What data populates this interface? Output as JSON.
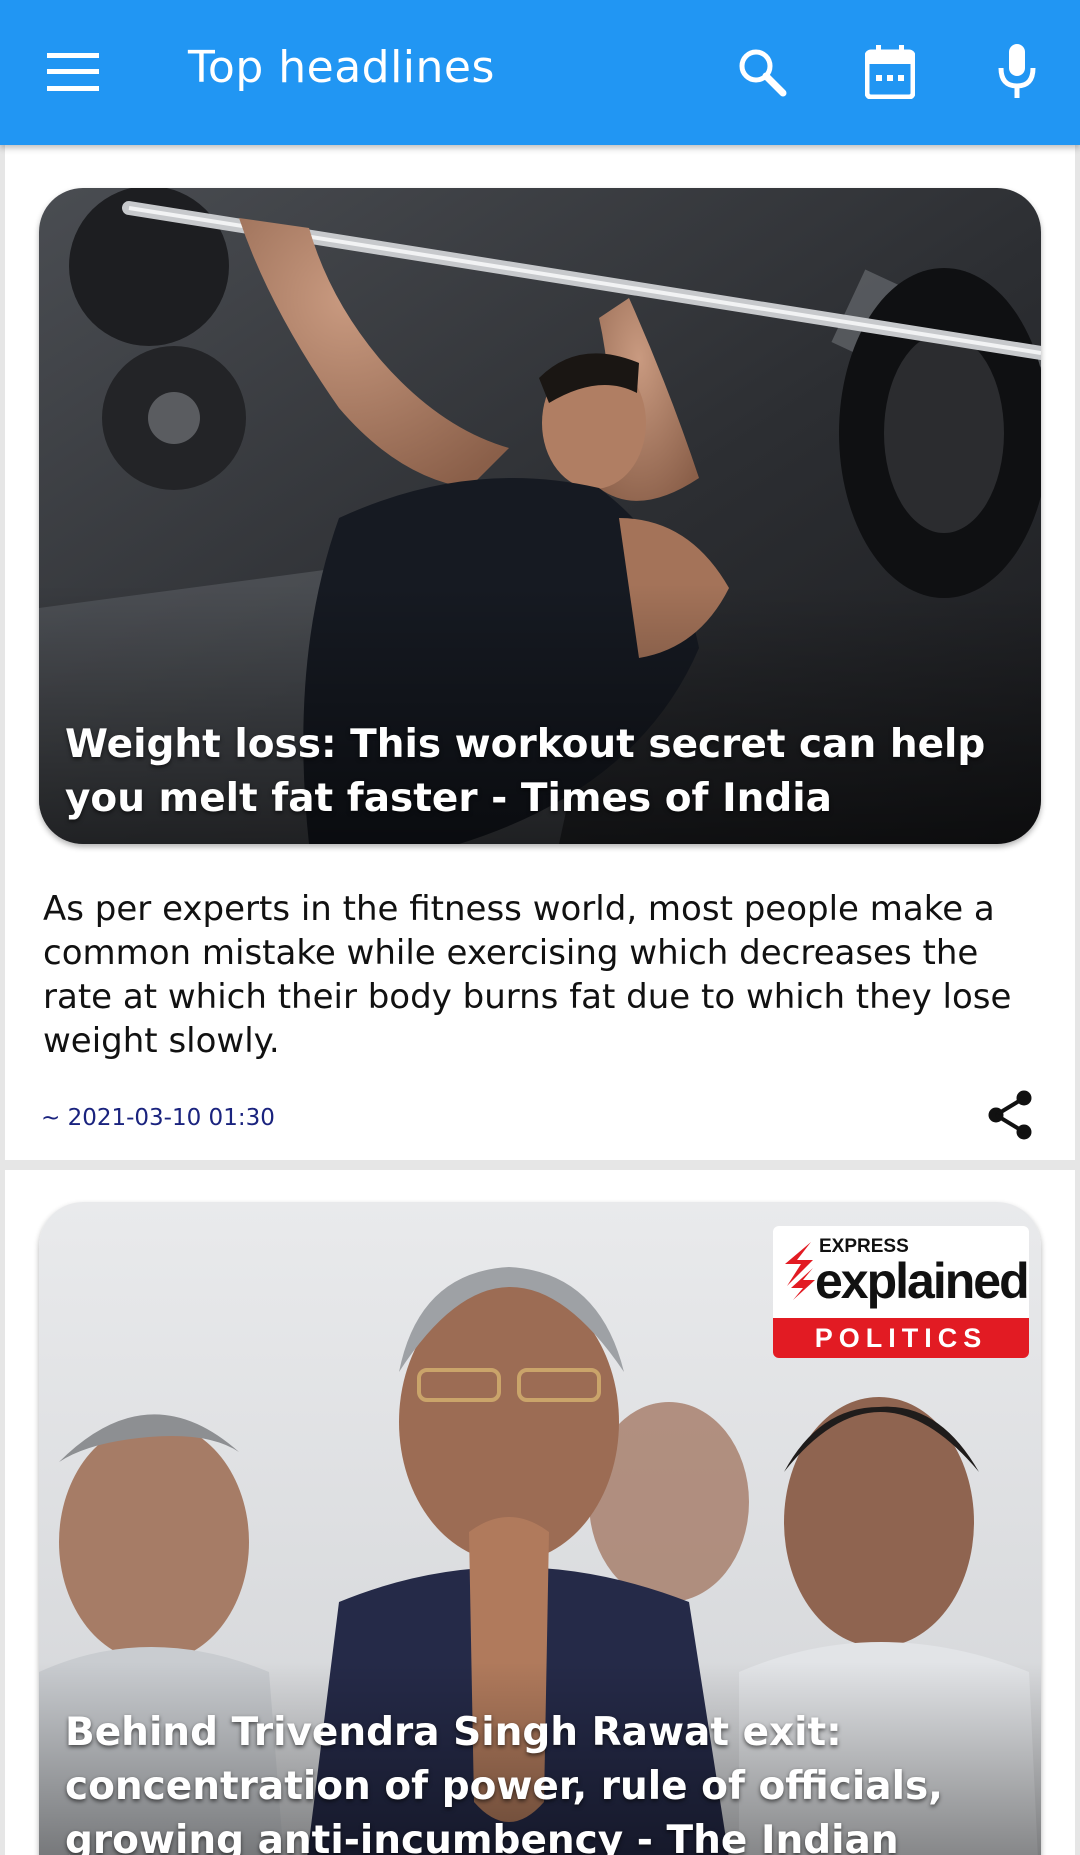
{
  "appbar": {
    "title": "Top headlines",
    "icons": [
      "menu-icon",
      "search-icon",
      "calendar-icon",
      "mic-icon"
    ],
    "background": "#2196f3"
  },
  "articles": [
    {
      "headline": "Weight loss: This workout secret can help you melt fat faster - Times of India",
      "description": "As per experts in the fitness world, most people make a common mistake while exercising which decreases the rate at which their body burns fat due to which they lose weight slowly.",
      "published": "~ 2021-03-10 01:30",
      "share_icon": "share-icon"
    },
    {
      "headline": "Behind Trivendra Singh Rawat exit: concentration of power, rule of officials, growing anti-incumbency - The Indian Express",
      "badge": {
        "top": "EXPRESS",
        "main": "explained",
        "dot": ".",
        "section": "POLITICS"
      }
    }
  ]
}
